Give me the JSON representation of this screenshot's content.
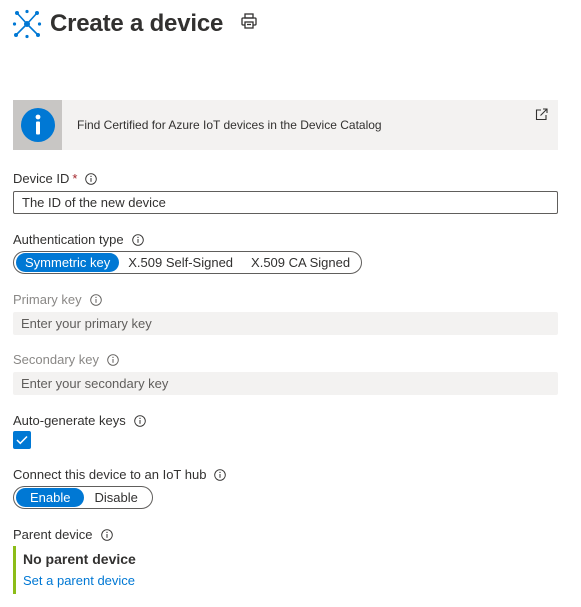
{
  "header": {
    "title": "Create a device",
    "icon": "iot-hub-icon",
    "print_icon": "print-icon"
  },
  "banner": {
    "icon": "info-icon",
    "text": "Find Certified for Azure IoT devices in the Device Catalog",
    "link_icon": "open-external-icon"
  },
  "device_id": {
    "label": "Device ID",
    "required_marker": "*",
    "placeholder": "The ID of the new device"
  },
  "auth_type": {
    "label": "Authentication type",
    "options": [
      "Symmetric key",
      "X.509 Self-Signed",
      "X.509 CA Signed"
    ],
    "selected": "Symmetric key"
  },
  "primary_key": {
    "label": "Primary key",
    "placeholder": "Enter your primary key"
  },
  "secondary_key": {
    "label": "Secondary key",
    "placeholder": "Enter your secondary key"
  },
  "auto_generate": {
    "label": "Auto-generate keys",
    "checked": true
  },
  "connect_hub": {
    "label": "Connect this device to an IoT hub",
    "options": [
      "Enable",
      "Disable"
    ],
    "selected": "Enable"
  },
  "parent_device": {
    "label": "Parent device",
    "value": "No parent device",
    "link": "Set a parent device"
  },
  "colors": {
    "accent": "#0078d4",
    "required": "#a4262c",
    "parent_bar": "#8cbd18",
    "banner_bg": "#f3f2f1"
  }
}
